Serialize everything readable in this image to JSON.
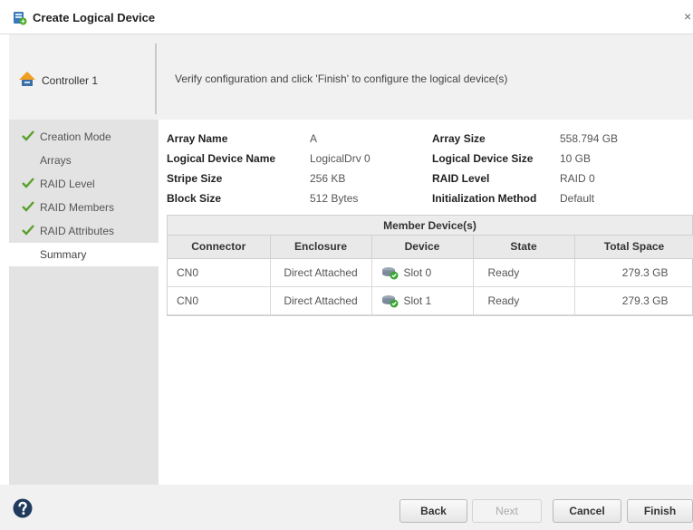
{
  "dialog": {
    "title": "Create Logical Device",
    "close_glyph": "×"
  },
  "header": {
    "controller_label": "Controller 1",
    "message": "Verify configuration and click 'Finish' to configure the logical device(s)"
  },
  "sidebar": {
    "items": [
      {
        "label": "Creation Mode",
        "checked": true,
        "active": false
      },
      {
        "label": "Arrays",
        "checked": false,
        "active": false
      },
      {
        "label": "RAID Level",
        "checked": true,
        "active": false
      },
      {
        "label": "RAID Members",
        "checked": true,
        "active": false
      },
      {
        "label": "RAID Attributes",
        "checked": true,
        "active": false
      },
      {
        "label": "Summary",
        "checked": false,
        "active": true
      }
    ]
  },
  "summary": {
    "array_name_label": "Array Name",
    "array_name": "A",
    "logical_device_name_label": "Logical Device Name",
    "logical_device_name": "LogicalDrv 0",
    "stripe_size_label": "Stripe Size",
    "stripe_size": "256 KB",
    "block_size_label": "Block Size",
    "block_size": "512 Bytes",
    "array_size_label": "Array Size",
    "array_size": "558.794 GB",
    "logical_device_size_label": "Logical Device Size",
    "logical_device_size": "10 GB",
    "raid_level_label": "RAID Level",
    "raid_level": "RAID 0",
    "init_method_label": "Initialization Method",
    "init_method": "Default"
  },
  "members": {
    "title": "Member Device(s)",
    "columns": [
      "Connector",
      "Enclosure",
      "Device",
      "State",
      "Total Space"
    ],
    "rows": [
      {
        "connector": "CN0",
        "enclosure": "Direct Attached",
        "device": "Slot 0",
        "state": "Ready",
        "total_space": "279.3 GB"
      },
      {
        "connector": "CN0",
        "enclosure": "Direct Attached",
        "device": "Slot 1",
        "state": "Ready",
        "total_space": "279.3 GB"
      }
    ]
  },
  "footer": {
    "back": "Back",
    "next": "Next",
    "cancel": "Cancel",
    "finish": "Finish"
  },
  "colors": {
    "check": "#5aa02c",
    "sidebar_bg": "#e3e3e3",
    "header_bg": "#f1f1f1",
    "help": "#1f3a5c"
  },
  "icons": {
    "title": "create-logical-device-icon",
    "controller": "controller-icon",
    "device": "disk-ok-icon",
    "help": "help-icon",
    "check": "checkmark-icon"
  }
}
